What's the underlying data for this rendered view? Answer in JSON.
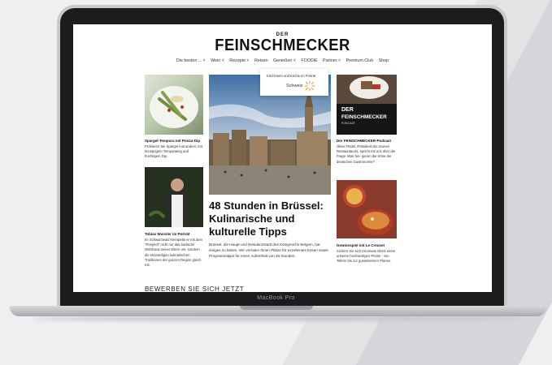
{
  "site": {
    "logo_small": "DER",
    "logo_main": "FEINSCHMECKER"
  },
  "nav": {
    "items": [
      "Die besten ... ˅",
      "Wein ˅",
      "Rezepte ˅",
      "Reisen",
      "Genießen ˅",
      "FOODIE",
      "Partner ˅",
      "Premium Club",
      "Shop"
    ]
  },
  "dropdown": {
    "item1": "Köchinnen und Köche im Porträt",
    "item2": "Schweiz"
  },
  "left": {
    "article1_title": "Spargel-Tempura mit Ponzu-Dip",
    "article1_body": "Probieren Sie Spargel mal anders: mit knusprigem Tempurateig und fruchtigem Dip.",
    "article2_title": "Tobias Wussler im Porträt",
    "article2_body": "Im Schwarzwald krempelte er mit dem \"Ponyhof\" nicht nur das badische Wirtshaus seiner Eltern um, sondern die ehrwürdigen kulinarischen Traditionen der ganzen Region gleich mit."
  },
  "center": {
    "title": "48 Stunden in Brüssel: Kulinarische und kulturelle Tipps",
    "body": "Brüssel, die Haupt-und Residenzstadt des Königreichs Belgien, hat einiges zu bieten. Wir verraten Ihnen Plätze für exzellentes Essen sowie Programmtipps für einen Aufenthalt von 48 Stunden."
  },
  "right": {
    "podcast_der": "DER",
    "podcast_name": "FEINSCHMECKER",
    "podcast_tag": "PODCAST",
    "article1_title": "Der FEINSCHMECKER-Podcast",
    "article1_body": "Oliver Rödel, Präsident der Jeunes Restaurateurs, spricht mit uns über die Frage: Was fun- gieren die Köne der deutschen Gastronomie?",
    "article2_title": "Gewinnspiel mit Le Creuset",
    "article2_body": "Sichern Sie sich mit etwas Glück einen unseren hochwertigen Preise - von Tellern bis zur gusseisernen Pfanne."
  },
  "footer": {
    "heading": "BEWERBEN SIE SICH JETZT"
  },
  "device": {
    "label": "MacBook Pro"
  }
}
